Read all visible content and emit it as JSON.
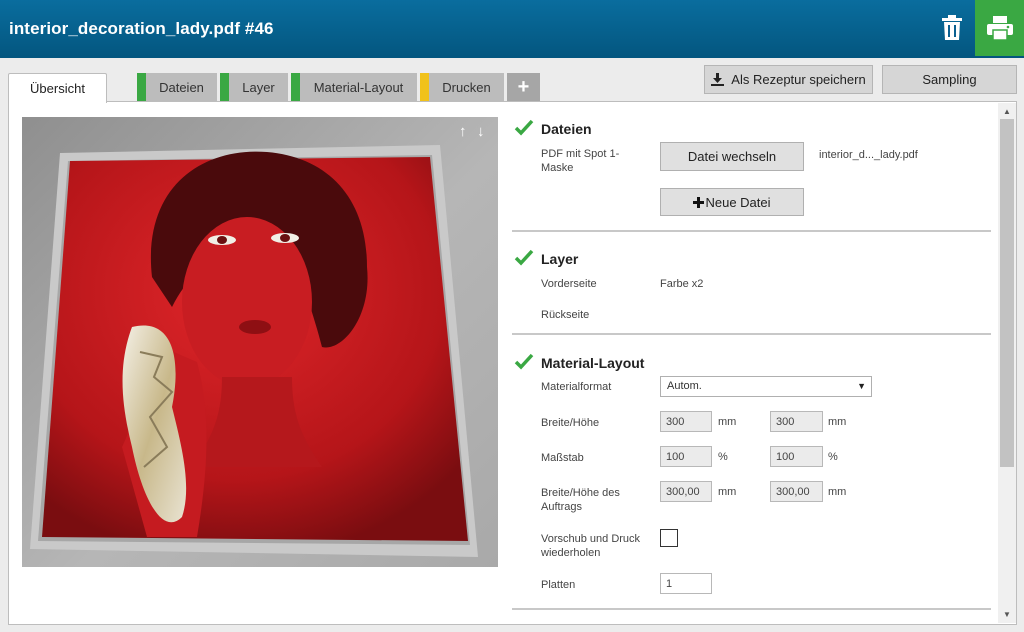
{
  "header": {
    "title": "interior_decoration_lady.pdf #46",
    "trash_icon": "trash-icon",
    "print_icon": "printer-icon"
  },
  "tabs": [
    {
      "label": "Übersicht",
      "active": true
    },
    {
      "label": "Dateien",
      "status_color": "#3aa843"
    },
    {
      "label": "Layer",
      "status_color": "#3aa843"
    },
    {
      "label": "Material-Layout",
      "status_color": "#3aa843"
    },
    {
      "label": "Drucken",
      "status_color": "#f1c21b"
    },
    {
      "label": "+"
    }
  ],
  "actions": {
    "save_recipe": "Als Rezeptur speichern",
    "sampling": "Sampling"
  },
  "preview": {
    "arrow_up": "↑",
    "arrow_down": "↓"
  },
  "sections": {
    "dateien": {
      "title": "Dateien",
      "pdf_label": "PDF mit Spot 1-Maske",
      "change_file_button": "Datei wechseln",
      "filename": "interior_d..._lady.pdf",
      "new_file_button": "Neue Datei"
    },
    "layer": {
      "title": "Layer",
      "front_label": "Vorderseite",
      "front_value": "Farbe x2",
      "back_label": "Rückseite"
    },
    "material": {
      "title": "Material-Layout",
      "format_label": "Materialformat",
      "format_value": "Autom.",
      "size_label": "Breite/Höhe",
      "width": "300",
      "height": "300",
      "size_unit": "mm",
      "scale_label": "Maßstab",
      "scale_x": "100",
      "scale_y": "100",
      "scale_unit": "%",
      "job_size_label": "Breite/Höhe des Auftrags",
      "job_width": "300,00",
      "job_height": "300,00",
      "job_unit": "mm",
      "repeat_label": "Vorschub und Druck wiederholen",
      "plates_label": "Platten",
      "plates_value": "1"
    }
  },
  "colors": {
    "header": "#03567f",
    "accent_green": "#3aa843",
    "accent_yellow": "#f1c21b"
  }
}
